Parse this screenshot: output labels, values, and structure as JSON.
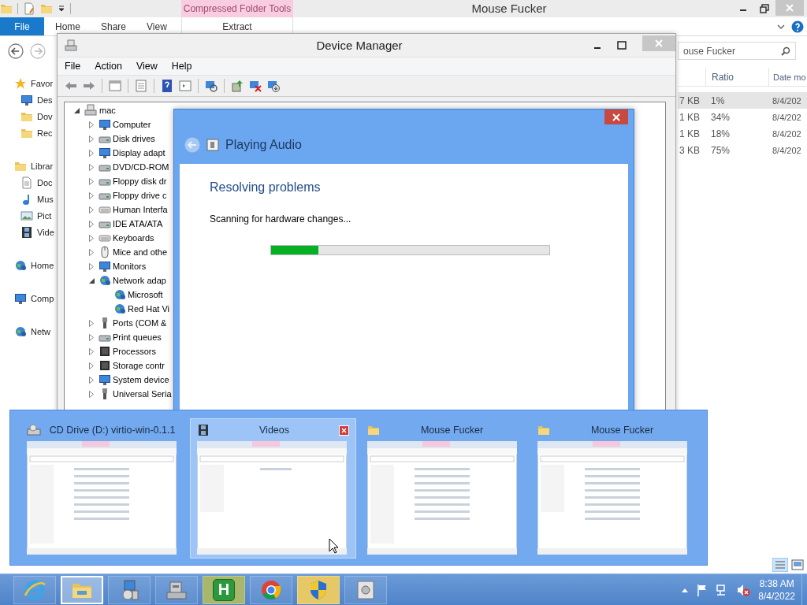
{
  "explorer": {
    "title": "Mouse Fucker",
    "context_group": "Compressed Folder Tools",
    "file_tab": "File",
    "ribbon_tabs": [
      {
        "label": "Home",
        "kind": "standard",
        "selected": false
      },
      {
        "label": "Share",
        "kind": "standard",
        "selected": false
      },
      {
        "label": "View",
        "kind": "standard",
        "selected": false
      },
      {
        "label": "Extract",
        "kind": "contextual",
        "selected": false
      }
    ],
    "search": {
      "value": "ouse Fucker"
    },
    "columns": [
      "Ratio",
      "Date mo"
    ],
    "rows": [
      {
        "size": "7 KB",
        "ratio": "1%",
        "date": "8/4/202",
        "selected": true
      },
      {
        "size": "1 KB",
        "ratio": "34%",
        "date": "8/4/202",
        "selected": false
      },
      {
        "size": "1 KB",
        "ratio": "18%",
        "date": "8/4/202",
        "selected": false
      },
      {
        "size": "3 KB",
        "ratio": "75%",
        "date": "8/4/202",
        "selected": false
      }
    ],
    "sidebar": [
      {
        "label": "Favor",
        "children": [
          {
            "label": "Des"
          },
          {
            "label": "Dov"
          },
          {
            "label": "Rec"
          }
        ]
      },
      {
        "label": "Librar",
        "children": [
          {
            "label": "Doc"
          },
          {
            "label": "Mus"
          },
          {
            "label": "Pict"
          },
          {
            "label": "Vide"
          }
        ]
      },
      {
        "label": "Home"
      },
      {
        "label": "Comp"
      },
      {
        "label": "Netw"
      }
    ]
  },
  "device_manager": {
    "title": "Device Manager",
    "menu": [
      "File",
      "Action",
      "View",
      "Help"
    ],
    "tree": [
      {
        "label": "mac",
        "expanded": true,
        "children": [
          {
            "label": "Computer",
            "expanded": false
          },
          {
            "label": "Disk drives",
            "expanded": false
          },
          {
            "label": "Display adapt",
            "expanded": false
          },
          {
            "label": "DVD/CD-ROM",
            "expanded": false
          },
          {
            "label": "Floppy disk dr",
            "expanded": false
          },
          {
            "label": "Floppy drive c",
            "expanded": false
          },
          {
            "label": "Human Interfa",
            "expanded": false
          },
          {
            "label": "IDE ATA/ATA",
            "expanded": false
          },
          {
            "label": "Keyboards",
            "expanded": false
          },
          {
            "label": "Mice and othe",
            "expanded": false
          },
          {
            "label": "Monitors",
            "expanded": false
          },
          {
            "label": "Network adap",
            "expanded": true,
            "children": [
              {
                "label": "Microsoft"
              },
              {
                "label": "Red Hat Vi"
              }
            ]
          },
          {
            "label": "Ports (COM &",
            "expanded": false
          },
          {
            "label": "Print queues",
            "expanded": false
          },
          {
            "label": "Processors",
            "expanded": false
          },
          {
            "label": "Storage contr",
            "expanded": false
          },
          {
            "label": "System device",
            "expanded": false
          },
          {
            "label": "Universal Seria",
            "expanded": false
          }
        ]
      }
    ]
  },
  "dialog": {
    "title": "Playing Audio",
    "heading": "Resolving problems",
    "status": "Scanning for hardware changes...",
    "progress": {
      "level": 0.17
    }
  },
  "previews": [
    {
      "title": "CD Drive (D:) virtio-win-0.1.1",
      "selected": false
    },
    {
      "title": "Videos",
      "selected": true
    },
    {
      "title": "Mouse Fucker",
      "selected": false
    },
    {
      "title": "Mouse Fucker",
      "selected": false
    }
  ],
  "taskbar": {
    "apps": [
      {
        "selected": false,
        "highlighted": false
      },
      {
        "selected": true,
        "highlighted": false
      },
      {
        "selected": false,
        "highlighted": false
      },
      {
        "selected": false,
        "highlighted": false
      },
      {
        "label": "H",
        "selected": false,
        "highlighted": true
      },
      {
        "selected": false,
        "highlighted": false
      },
      {
        "selected": false,
        "highlighted": true
      },
      {
        "selected": false,
        "highlighted": false
      }
    ],
    "clock": {
      "time": "8:38 AM",
      "date": "8/4/2022"
    }
  }
}
